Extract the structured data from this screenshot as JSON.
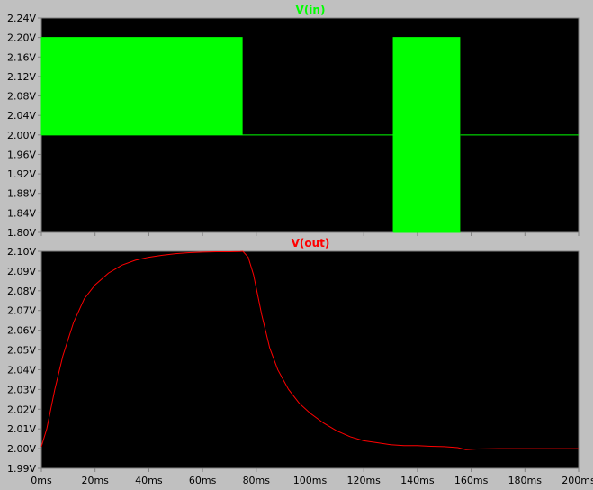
{
  "colors": {
    "background": "#c0c0c0",
    "plot_bg": "#000000",
    "axis": "#808080",
    "tick_text": "#000000",
    "vin": "#00ff00",
    "vout": "#ff0000"
  },
  "chart_data": [
    {
      "type": "line",
      "title": "V(in)",
      "title_color": "#00ff00",
      "xlim": [
        0,
        200
      ],
      "ylim": [
        1.8,
        2.24
      ],
      "x_ticks": [
        "0ms",
        "20ms",
        "40ms",
        "60ms",
        "80ms",
        "100ms",
        "120ms",
        "140ms",
        "160ms",
        "180ms",
        "200ms"
      ],
      "y_ticks": [
        "1.80V",
        "1.84V",
        "1.88V",
        "1.92V",
        "1.96V",
        "2.00V",
        "2.04V",
        "2.08V",
        "2.12V",
        "2.16V",
        "2.20V",
        "2.24V"
      ],
      "grid": false,
      "series": [
        {
          "color": "#00ff00",
          "segments": [
            {
              "x_start": 0,
              "x_end": 75,
              "low": 2.0,
              "high": 2.2,
              "pulse_period": 0.5,
              "duty": 0.5
            },
            {
              "x_start": 75,
              "x_end": 131,
              "value": 2.0
            },
            {
              "x_start": 131,
              "x_end": 156,
              "low": 1.8,
              "high": 2.2,
              "pulse_period": 0.5,
              "duty": 0.5
            },
            {
              "x_start": 156,
              "x_end": 200,
              "value": 2.0
            }
          ]
        }
      ]
    },
    {
      "type": "line",
      "title": "V(out)",
      "title_color": "#ff0000",
      "xlim": [
        0,
        200
      ],
      "ylim": [
        1.99,
        2.1
      ],
      "x_ticks": [
        "0ms",
        "20ms",
        "40ms",
        "60ms",
        "80ms",
        "100ms",
        "120ms",
        "140ms",
        "160ms",
        "180ms",
        "200ms"
      ],
      "y_ticks": [
        "1.99V",
        "2.00V",
        "2.01V",
        "2.02V",
        "2.03V",
        "2.04V",
        "2.05V",
        "2.06V",
        "2.07V",
        "2.08V",
        "2.09V",
        "2.10V"
      ],
      "grid": false,
      "series": [
        {
          "color": "#ff0000",
          "x": [
            0,
            2,
            5,
            8,
            12,
            16,
            20,
            25,
            30,
            35,
            40,
            45,
            50,
            55,
            60,
            65,
            70,
            74,
            75,
            77,
            79,
            82,
            85,
            88,
            92,
            96,
            100,
            105,
            110,
            115,
            120,
            125,
            130,
            135,
            140,
            145,
            150,
            155,
            158,
            162,
            170,
            180,
            190,
            200
          ],
          "values": [
            2.001,
            2.01,
            2.03,
            2.047,
            2.064,
            2.076,
            2.083,
            2.089,
            2.093,
            2.0955,
            2.097,
            2.098,
            2.0988,
            2.0993,
            2.0996,
            2.0998,
            2.0998,
            2.0999,
            2.1,
            2.097,
            2.088,
            2.068,
            2.051,
            2.04,
            2.03,
            2.023,
            2.018,
            2.013,
            2.009,
            2.006,
            2.004,
            2.003,
            2.002,
            2.0015,
            2.0015,
            2.0012,
            2.001,
            2.0005,
            1.9995,
            1.9998,
            2.0,
            2.0,
            2.0,
            2.0
          ]
        }
      ]
    }
  ]
}
